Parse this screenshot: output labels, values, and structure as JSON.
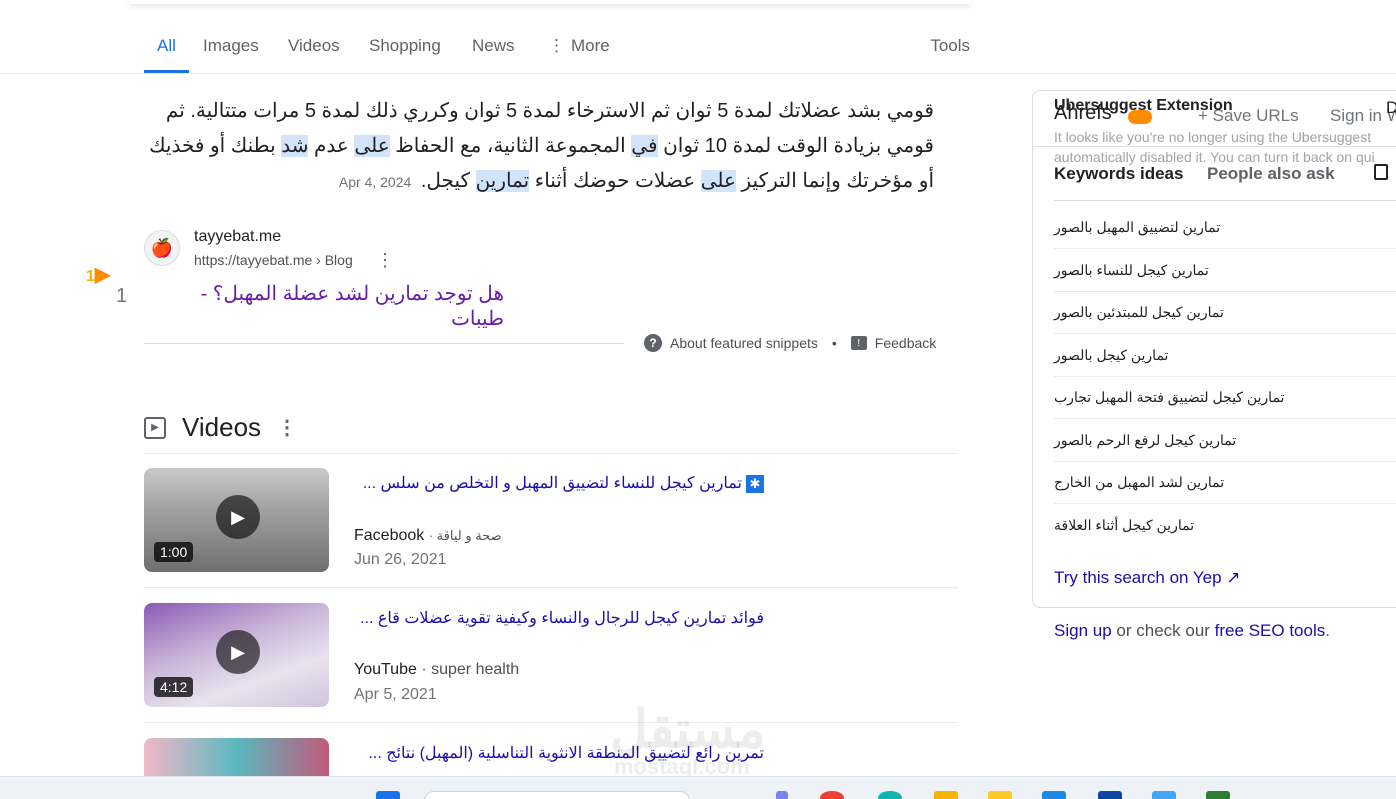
{
  "tabs": {
    "all": "All",
    "images": "Images",
    "videos": "Videos",
    "shopping": "Shopping",
    "news": "News",
    "more": "More",
    "tools": "Tools"
  },
  "snippet": {
    "t1": "قومي بشد عضلاتك لمدة 5 ثوان ثم الاسترخاء لمدة 5 ثوان وكرري ذلك لمدة 5 مرات متتالية. ثم قومي بزيادة الوقت لمدة 10 ثوان ",
    "h1": "في",
    "t2": " المجموعة الثانية، مع الحفاظ ",
    "h2": "على",
    "t3": " عدم ",
    "h3": "شد",
    "t4": " بطنك أو فخذيك أو مؤخرتك وإنما التركيز ",
    "h4": "على",
    "t5": " عضلات حوضك أثناء ",
    "h5": "تمارين",
    "t6": " كيجل.",
    "date": "Apr 4, 2024"
  },
  "source": {
    "name": "tayyebat.me",
    "url": "https://tayyebat.me › Blog",
    "title": "هل توجد تمارين لشد عضلة المهبل؟ - طيبات",
    "rank_arrow": "1",
    "rank": "1"
  },
  "snippet_footer": {
    "about": "About featured snippets",
    "bullet": "•",
    "feedback": "Feedback"
  },
  "videos": {
    "heading": "Videos",
    "items": [
      {
        "title": "تمارين كيجل للنساء لتضييق المهبل و التخلص من سلس ...",
        "platform": "Facebook",
        "channel": "· صحة و لياقة",
        "date": "Jun 26, 2021",
        "duration": "1:00",
        "thumb_color": "#8a8a8a"
      },
      {
        "title": "فوائد تمارين كيجل للرجال والنساء وكيفية تقوية عضلات قاع ...",
        "platform": "YouTube",
        "channel": "· super health",
        "date": "Apr 5, 2021",
        "duration": "4:12",
        "thumb_color": "#7b4aa0"
      },
      {
        "title": "تمرين رائع لتضييق المنطقة الانثوية التناسلية (المهبل) نتائج ...",
        "platform": "",
        "channel": "",
        "date": "",
        "duration": "",
        "thumb_color": "#c86a8a"
      }
    ]
  },
  "panel": {
    "ahrefs": "Ahrefs",
    "save_urls": "+ Save URLs",
    "sign_in": "Sign in W",
    "d": "D",
    "uber_title": "Ubersuggest Extension",
    "uber_msg1": "It looks like you're no longer using the Ubersuggest",
    "uber_msg2": "automatically disabled it. You can turn it back on qui",
    "tab_keywords": "Keywords ideas",
    "tab_people": "People also ask",
    "keywords": [
      "تمارين لتضييق المهبل بالصور",
      "تمارين كيجل للنساء بالصور",
      "تمارين كيجل للمبتدئين بالصور",
      "تمارين كيجل بالصور",
      "تمارين كيجل لتضييق فتحة المهبل تجارب",
      "تمارين كيجل لرفع الرحم بالصور",
      "تمارين لشد المهبل من الخارج",
      "تمارين كيجل أثناء العلاقة"
    ],
    "yep": "Try this search on Yep ↗",
    "signup": "Sign up",
    "signup_mid": " or check our ",
    "free_seo": "free SEO tools",
    "signup_end": "."
  },
  "watermark": {
    "arabic": "مستقل",
    "latin": "mostaql.com"
  }
}
